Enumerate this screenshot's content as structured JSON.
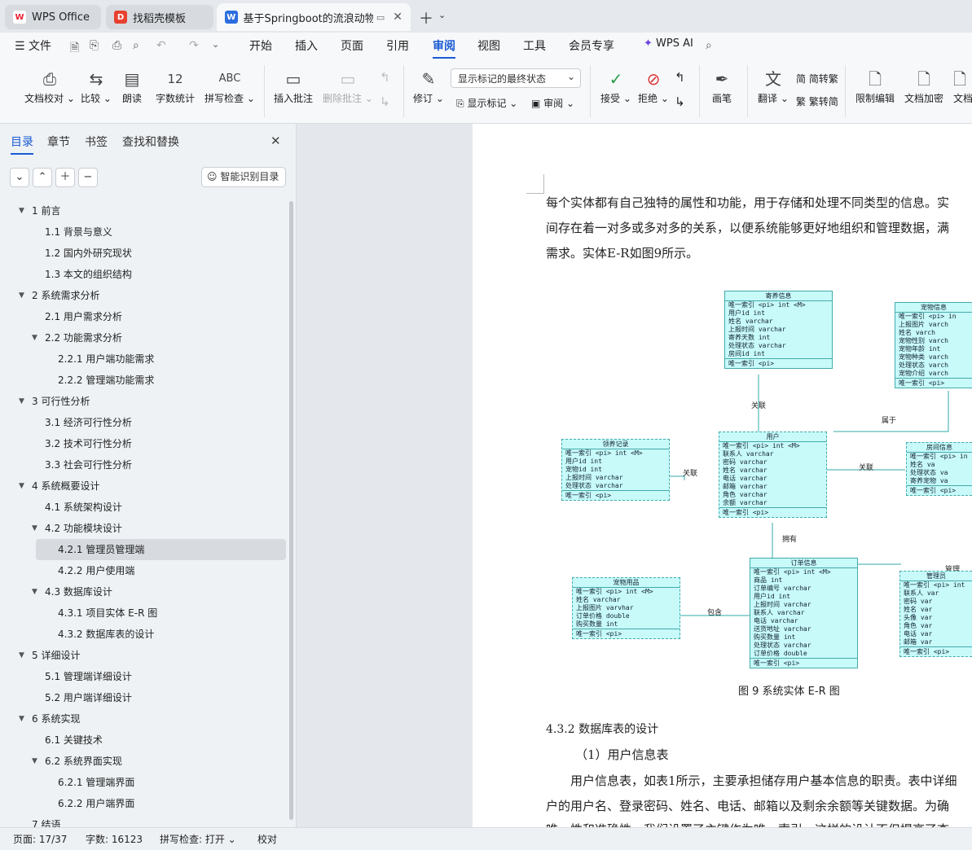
{
  "tabs": [
    {
      "label": "WPS Office",
      "icon": "wps-logo-icon"
    },
    {
      "label": "找稻壳模板",
      "icon": "docer-icon"
    },
    {
      "label": "基于Springboot的流浪动物管",
      "icon": "word-doc-icon"
    }
  ],
  "menu": {
    "file": "文件",
    "items": [
      "开始",
      "插入",
      "页面",
      "引用",
      "审阅",
      "视图",
      "工具",
      "会员专享"
    ],
    "active": "审阅",
    "ai": "WPS AI"
  },
  "ribbon": {
    "doc_check": "文档校对",
    "compare": "比较",
    "read": "朗读",
    "word_count": "字数统计",
    "spell": "拼写检查",
    "insert_comment": "插入批注",
    "delete_comment": "删除批注",
    "revise": "修订",
    "display_select": "显示标记的最终状态",
    "show_marks": "显示标记",
    "review": "审阅",
    "accept": "接受",
    "reject": "拒绝",
    "pen": "画笔",
    "translate": "翻译",
    "to_trad": "简转繁",
    "to_simp": "繁转简",
    "restrict": "限制编辑",
    "encrypt": "文档加密",
    "doc_more": "文档"
  },
  "panel": {
    "tabs": [
      "目录",
      "章节",
      "书签",
      "查找和替换"
    ],
    "smart_btn": "智能识别目录",
    "toc": [
      {
        "text": "1 前言",
        "level": 1,
        "caret": true
      },
      {
        "text": "1.1 背景与意义",
        "level": 2
      },
      {
        "text": "1.2 国内外研究现状",
        "level": 2
      },
      {
        "text": "1.3 本文的组织结构",
        "level": 2
      },
      {
        "text": "2 系统需求分析",
        "level": 1,
        "caret": true
      },
      {
        "text": "2.1 用户需求分析",
        "level": 2
      },
      {
        "text": "2.2 功能需求分析",
        "level": 2,
        "caret": true
      },
      {
        "text": "2.2.1 用户端功能需求",
        "level": 3
      },
      {
        "text": "2.2.2 管理端功能需求",
        "level": 3
      },
      {
        "text": "3 可行性分析",
        "level": 1,
        "caret": true
      },
      {
        "text": "3.1 经济可行性分析",
        "level": 2
      },
      {
        "text": "3.2 技术可行性分析",
        "level": 2
      },
      {
        "text": "3.3 社会可行性分析",
        "level": 2
      },
      {
        "text": "4 系统概要设计",
        "level": 1,
        "caret": true
      },
      {
        "text": "4.1 系统架构设计",
        "level": 2
      },
      {
        "text": "4.2 功能模块设计",
        "level": 2,
        "caret": true
      },
      {
        "text": "4.2.1 管理员管理端",
        "level": 3,
        "selected": true
      },
      {
        "text": "4.2.2 用户使用端",
        "level": 3
      },
      {
        "text": "4.3 数据库设计",
        "level": 2,
        "caret": true
      },
      {
        "text": "4.3.1 项目实体 E-R 图",
        "level": 3
      },
      {
        "text": "4.3.2 数据库表的设计",
        "level": 3
      },
      {
        "text": "5 详细设计",
        "level": 1,
        "caret": true
      },
      {
        "text": "5.1 管理端详细设计",
        "level": 2
      },
      {
        "text": "5.2 用户端详细设计",
        "level": 2
      },
      {
        "text": "6  系统实现",
        "level": 1,
        "caret": true
      },
      {
        "text": "6.1 关键技术",
        "level": 2
      },
      {
        "text": "6.2 系统界面实现",
        "level": 2,
        "caret": true
      },
      {
        "text": "6.2.1 管理端界面",
        "level": 3
      },
      {
        "text": "6.2.2 用户端界面",
        "level": 3
      },
      {
        "text": "7 结语",
        "level": 1
      }
    ]
  },
  "doc": {
    "p1": "每个实体都有自己独特的属性和功能，用于存储和处理不同类型的信息。实",
    "p2": "间存在着一对多或多对多的关系，以便系统能够更好地组织和管理数据，满",
    "p3": "需求。实体E-R如图9所示。",
    "caption": "图 9  系统实体 E-R 图",
    "h432": "4.3.2 数据库表的设计",
    "h1": "（1）用户信息表",
    "p4": "用户信息表，如表1所示，主要承担储存用户基本信息的职责。表中详细",
    "p5": "户的用户名、登录密码、姓名、电话、邮箱以及剩余余额等关键数据。为确",
    "p6": "唯一性和准确性，我们设置了主键作为唯一索引，这样的设计不但提高了查"
  },
  "er": {
    "entities": [
      {
        "id": "jiyang",
        "title": "寄养信息",
        "rows": [
          "唯一索引  <pi> int   <M>",
          "用户id        int",
          "姓名          varchar",
          "上报时间      varchar",
          "寄养天数      int",
          "处理状态      varchar",
          "房间id        int"
        ],
        "footer": "唯一索引  <pi>"
      },
      {
        "id": "chongwu",
        "title": "宠物信息",
        "rows": [
          "唯一索引  <pi>  in",
          "上报图片      varch",
          "姓名          varch",
          "宠物性别      varch",
          "宠物年龄      int",
          "宠物种类      varch",
          "处理状态      varch",
          "宠物介绍      varch"
        ],
        "footer": "唯一索引  <pi>"
      },
      {
        "id": "lingyang",
        "title": "领养记录",
        "rows": [
          "唯一索引  <pi>  int   <M>",
          "用户id         int",
          "宠物id         int",
          "上报时间       varchar",
          "处理状态       varchar"
        ],
        "footer": "唯一索引  <pi>"
      },
      {
        "id": "yonghu",
        "title": "用户",
        "rows": [
          "唯一索引  <pi>  int   <M>",
          "联系人         varchar",
          "密码           varchar",
          "姓名           varchar",
          "电话           varchar",
          "邮箱           varchar",
          "角色           varchar",
          "余额           varchar"
        ],
        "footer": "唯一索引  <pi>"
      },
      {
        "id": "fangjian",
        "title": "房间信息",
        "rows": [
          "唯一索引  <pi>  in",
          "姓名          va",
          "处理状态      va",
          "寄养宠物      va"
        ],
        "footer": "唯一索引  <pi>"
      },
      {
        "id": "yongpin",
        "title": "宠物用品",
        "rows": [
          "唯一索引  <pi>  int   <M>",
          "姓名           varchar",
          "上报图片       varvhar",
          "订单价格       double",
          "购买数量       int"
        ],
        "footer": "唯一索引  <pi>"
      },
      {
        "id": "dingdan",
        "title": "订单信息",
        "rows": [
          "唯一索引  <pi>  int   <M>",
          "商品           int",
          "订单编号       varchar",
          "用户id         int",
          "上报时间       varchar",
          "联系人         varchar",
          "电话           varchar",
          "送货地址       varchar",
          "购买数量       int",
          "处理状态       varchar",
          "订单价格       double"
        ],
        "footer": "唯一索引  <pi>"
      },
      {
        "id": "guanli",
        "title": "管理员",
        "rows": [
          "唯一索引  <pi>  int",
          "联系人         var",
          "密码           var",
          "姓名           var",
          "头像           var",
          "角色           var",
          "电话           var",
          "邮箱           var"
        ],
        "footer": "唯一索引  <pi>"
      }
    ],
    "relations": [
      "关联",
      "属于",
      "关联",
      "关联",
      "拥有",
      "包含",
      "管理"
    ]
  },
  "status": {
    "page": "页面: 17/37",
    "words": "字数: 16123",
    "spell": "拼写检查: 打开",
    "proof": "校对"
  }
}
